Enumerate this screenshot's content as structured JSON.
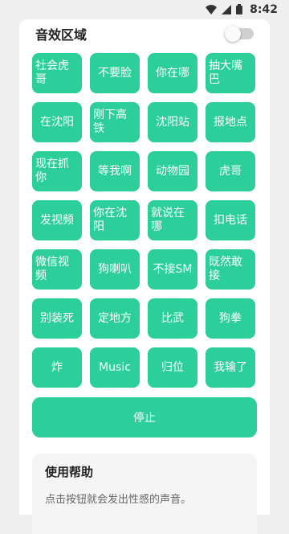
{
  "status_bar": {
    "time": "8:42"
  },
  "header": {
    "title": "音效区域",
    "toggle_on": false
  },
  "sound_buttons": [
    "社会虎哥",
    "不要脸",
    "你在哪",
    "抽大嘴巴",
    "在沈阳",
    "刚下高铁",
    "沈阳站",
    "报地点",
    "现在抓你",
    "等我啊",
    "动物园",
    "虎哥",
    "发视频",
    "你在沈阳",
    "就说在哪",
    "扣电话",
    "微信视频",
    "狗喇叭",
    "不接SM",
    "既然敢接",
    "别装死",
    "定地方",
    "比武",
    "狗拳",
    "炸",
    "Music",
    "归位",
    "我输了"
  ],
  "stop_button": "停止",
  "help": {
    "title": "使用帮助",
    "text": "点击按钮就会发出性感的声音。"
  }
}
